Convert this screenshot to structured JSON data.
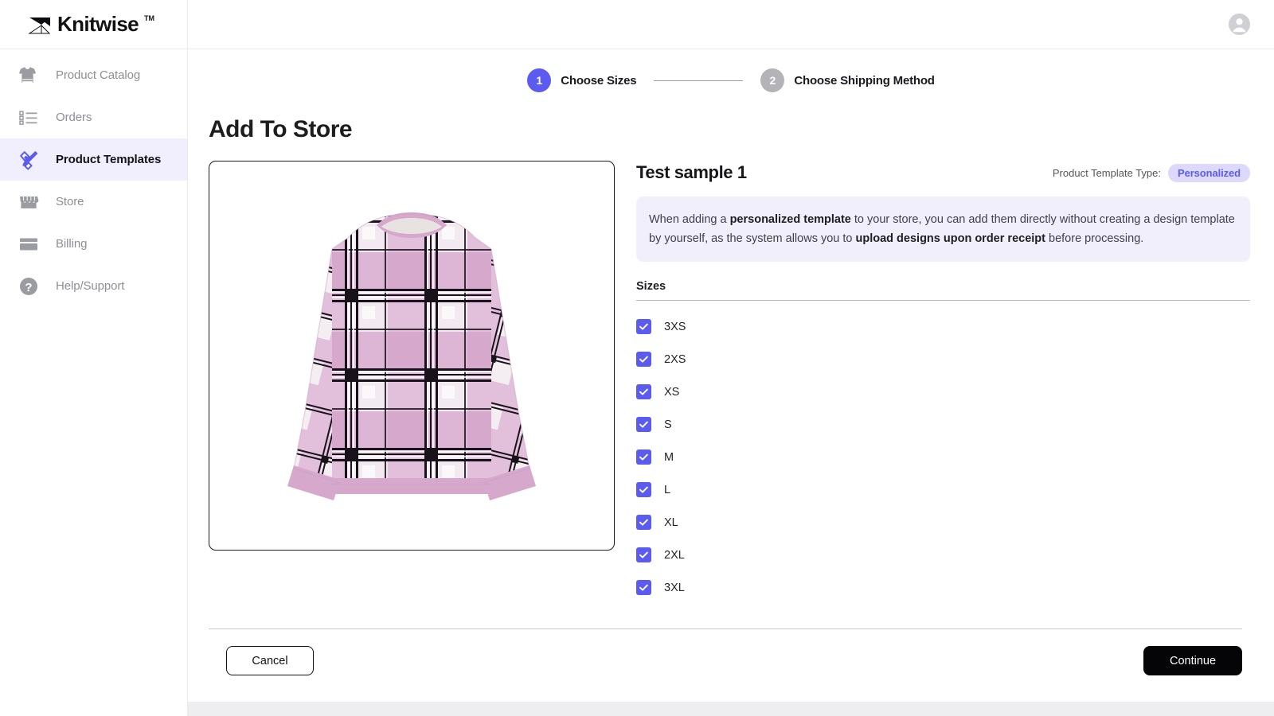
{
  "brand": {
    "name": "Knitwise",
    "trademark": "TM",
    "logo_icon": "knitwise-x-logo-icon"
  },
  "sidebar": {
    "items": [
      {
        "label": "Product Catalog",
        "icon": "sweater-icon",
        "active": false
      },
      {
        "label": "Orders",
        "icon": "list-icon",
        "active": false
      },
      {
        "label": "Product Templates",
        "icon": "pencil-ruler-icon",
        "active": true
      },
      {
        "label": "Store",
        "icon": "storefront-icon",
        "active": false
      },
      {
        "label": "Billing",
        "icon": "credit-card-icon",
        "active": false
      },
      {
        "label": "Help/Support",
        "icon": "question-mark-icon",
        "active": false
      }
    ]
  },
  "topbar": {
    "account_icon": "account-avatar-icon"
  },
  "stepper": {
    "steps": [
      {
        "number": "1",
        "label": "Choose Sizes",
        "state": "current"
      },
      {
        "number": "2",
        "label": "Choose Shipping Method",
        "state": "upcoming"
      }
    ]
  },
  "page": {
    "title": "Add To Store"
  },
  "product": {
    "image_alt": "pink-plaid-crewneck-sweater",
    "name": "Test sample 1",
    "template_type_label": "Product Template Type:",
    "template_type_value": "Personalized"
  },
  "info": {
    "part1": "When adding a ",
    "bold1": "personalized template",
    "part2": " to your store, you can add them directly without creating a design template by yourself, as the system allows you to ",
    "bold2": "upload designs upon order receipt",
    "part3": " before processing."
  },
  "sizes": {
    "title": "Sizes",
    "options": [
      {
        "label": "3XS",
        "checked": true
      },
      {
        "label": "2XS",
        "checked": true
      },
      {
        "label": "XS",
        "checked": true
      },
      {
        "label": "S",
        "checked": true
      },
      {
        "label": "M",
        "checked": true
      },
      {
        "label": "L",
        "checked": true
      },
      {
        "label": "XL",
        "checked": true
      },
      {
        "label": "2XL",
        "checked": true
      },
      {
        "label": "3XL",
        "checked": true
      }
    ]
  },
  "footer": {
    "cancel_label": "Cancel",
    "continue_label": "Continue"
  },
  "colors": {
    "accent": "#5b5bf0",
    "accent_soft": "#f1effd",
    "badge_bg": "#ddd9fb",
    "info_bg": "#f1effc",
    "muted_text": "#8e8e96",
    "dark": "#111114",
    "step_idle": "#b3b3b8",
    "sweater_pink": "#d6a8cc",
    "sweater_light_pink": "#e8d2e4",
    "sweater_white": "#f6f2f5",
    "sweater_black": "#161216"
  }
}
